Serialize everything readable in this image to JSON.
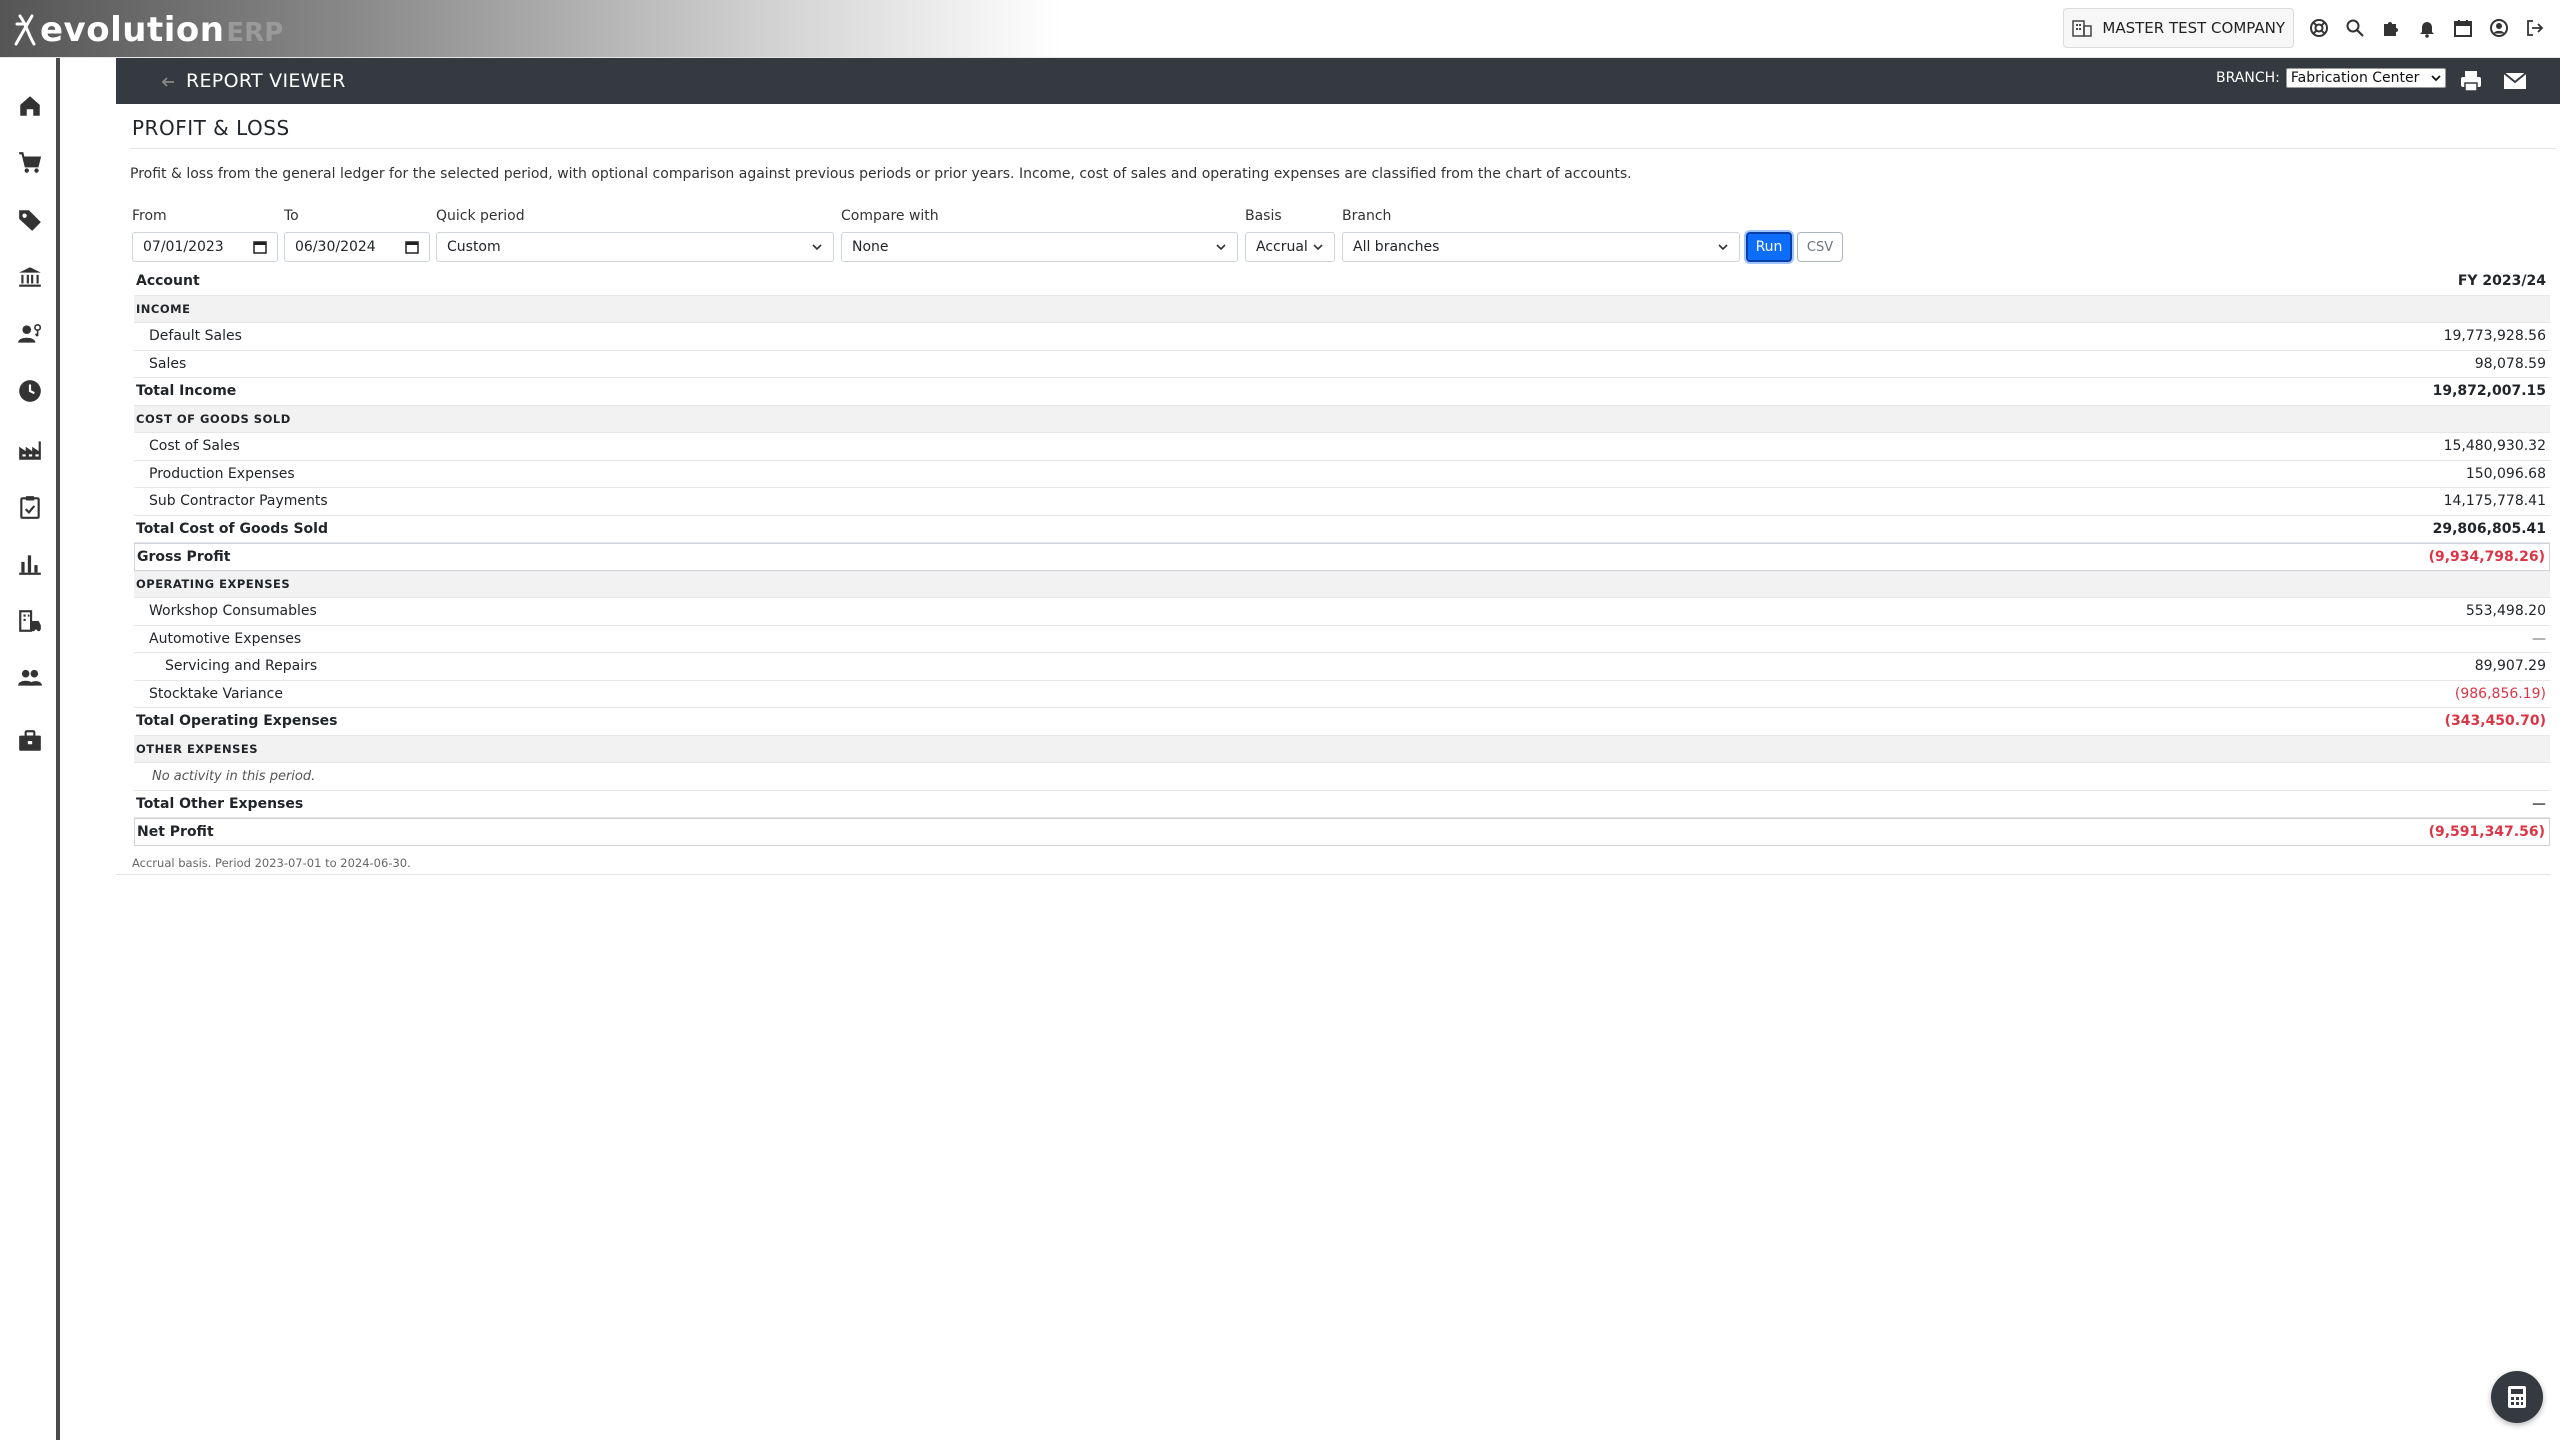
{
  "app": {
    "logo_text": "evolution",
    "logo_suffix": "ERP"
  },
  "topbar": {
    "company": "MASTER TEST COMPANY"
  },
  "header": {
    "title": "REPORT VIEWER",
    "branch_label": "BRANCH:",
    "branch_value": "Fabrication Center"
  },
  "page": {
    "title": "PROFIT & LOSS",
    "description": "Profit & loss from the general ledger for the selected period, with optional comparison against previous periods or prior years. Income, cost of sales and operating expenses are classified from the chart of accounts."
  },
  "filters": {
    "from_label": "From",
    "from_value": "07/01/2023",
    "to_label": "To",
    "to_value": "06/30/2024",
    "quick_label": "Quick period",
    "quick_value": "Custom",
    "compare_label": "Compare with",
    "compare_value": "None",
    "basis_label": "Basis",
    "basis_value": "Accrual",
    "branch_label": "Branch",
    "branch_value": "All branches",
    "run_label": "Run",
    "csv_label": "CSV"
  },
  "table": {
    "col_account": "Account",
    "col_period": "FY 2023/24",
    "rows": [
      {
        "kind": "section",
        "account": "INCOME",
        "amount": ""
      },
      {
        "kind": "item",
        "account": "Default Sales",
        "amount": "19,773,928.56"
      },
      {
        "kind": "item",
        "account": "Sales",
        "amount": "98,078.59"
      },
      {
        "kind": "total",
        "account": "Total Income",
        "amount": "19,872,007.15"
      },
      {
        "kind": "section",
        "account": "COST OF GOODS SOLD",
        "amount": ""
      },
      {
        "kind": "item",
        "account": "Cost of Sales",
        "amount": "15,480,930.32"
      },
      {
        "kind": "item",
        "account": "Production Expenses",
        "amount": "150,096.68"
      },
      {
        "kind": "item",
        "account": "Sub Contractor Payments",
        "amount": "14,175,778.41"
      },
      {
        "kind": "total",
        "account": "Total Cost of Goods Sold",
        "amount": "29,806,805.41"
      },
      {
        "kind": "boxed",
        "account": "Gross Profit",
        "amount": "(9,934,798.26)",
        "negative": true
      },
      {
        "kind": "section",
        "account": "OPERATING EXPENSES",
        "amount": ""
      },
      {
        "kind": "item",
        "account": "Workshop Consumables",
        "amount": "553,498.20"
      },
      {
        "kind": "item",
        "account": "Automotive Expenses",
        "amount": "—"
      },
      {
        "kind": "item2",
        "account": "Servicing and Repairs",
        "amount": "89,907.29"
      },
      {
        "kind": "item",
        "account": "Stocktake Variance",
        "amount": "(986,856.19)",
        "negative": true
      },
      {
        "kind": "total",
        "account": "Total Operating Expenses",
        "amount": "(343,450.70)",
        "negative": true
      },
      {
        "kind": "section",
        "account": "OTHER EXPENSES",
        "amount": ""
      },
      {
        "kind": "empty",
        "account": "No activity in this period.",
        "amount": ""
      },
      {
        "kind": "total",
        "account": "Total Other Expenses",
        "amount": "—"
      },
      {
        "kind": "boxed",
        "account": "Net Profit",
        "amount": "(9,591,347.56)",
        "negative": true
      }
    ],
    "footnote": "Accrual basis. Period 2023-07-01 to 2024-06-30."
  },
  "sidebar": {
    "items": [
      {
        "name": "home-icon"
      },
      {
        "name": "cart-icon"
      },
      {
        "name": "tag-icon"
      },
      {
        "name": "bank-icon"
      },
      {
        "name": "user-settings-icon"
      },
      {
        "name": "clock-icon"
      },
      {
        "name": "factory-icon"
      },
      {
        "name": "clipboard-check-icon"
      },
      {
        "name": "bar-chart-icon"
      },
      {
        "name": "building-car-icon"
      },
      {
        "name": "people-icon"
      },
      {
        "name": "briefcase-icon"
      }
    ]
  },
  "colors": {
    "accent": "#0d6efd",
    "negative": "#dc3545",
    "header_bg": "#343a40"
  }
}
